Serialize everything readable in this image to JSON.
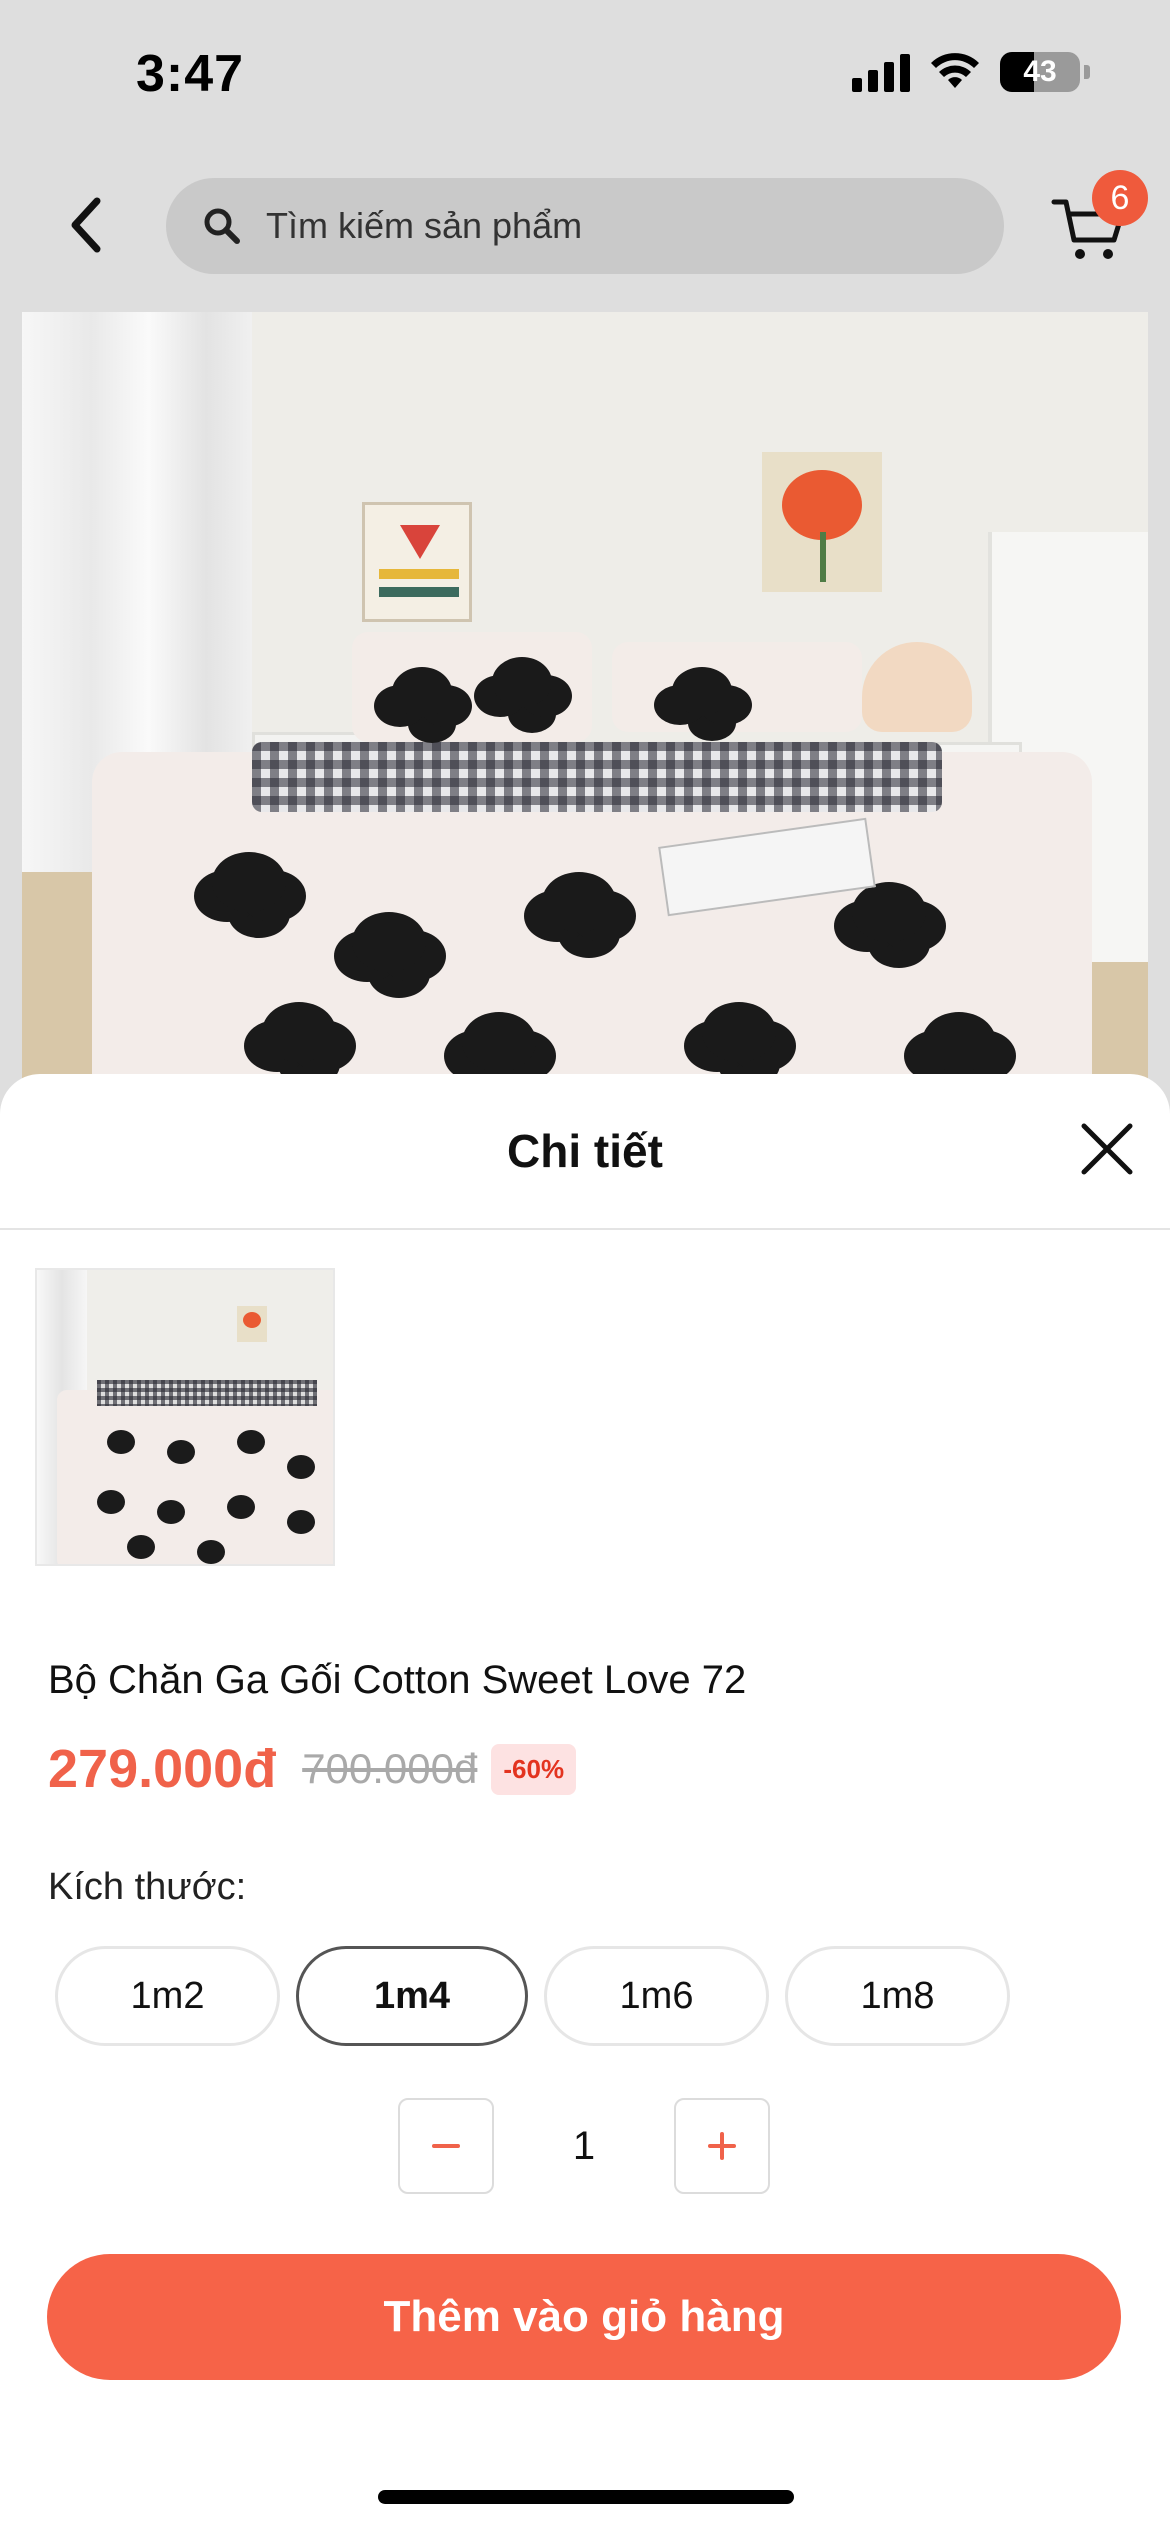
{
  "status_bar": {
    "time": "3:47",
    "battery_level": "43",
    "battery_fraction": 0.43
  },
  "header": {
    "search_placeholder": "Tìm kiếm sản phẩm",
    "cart_count": "6"
  },
  "sheet": {
    "title": "Chi tiết",
    "product": {
      "name": "Bộ Chăn Ga Gối Cotton Sweet Love 72",
      "price": "279.000đ",
      "original_price": "700.000đ",
      "discount": "-60%"
    },
    "size_label": "Kích thước:",
    "sizes": [
      {
        "label": "1m2",
        "selected": false
      },
      {
        "label": "1m4",
        "selected": true
      },
      {
        "label": "1m6",
        "selected": false
      },
      {
        "label": "1m8",
        "selected": false
      }
    ],
    "quantity": "1",
    "add_to_cart_label": "Thêm vào giỏ hàng"
  },
  "colors": {
    "accent": "#f66348",
    "price": "#f0624a",
    "badge_bg": "#fde2e2",
    "badge_text": "#e3331f",
    "cart_badge": "#ef5a3c"
  },
  "icons": [
    "back-arrow-icon",
    "search-icon",
    "cart-icon",
    "close-icon",
    "minus-icon",
    "plus-icon",
    "signal-icon",
    "wifi-icon",
    "battery-icon"
  ]
}
